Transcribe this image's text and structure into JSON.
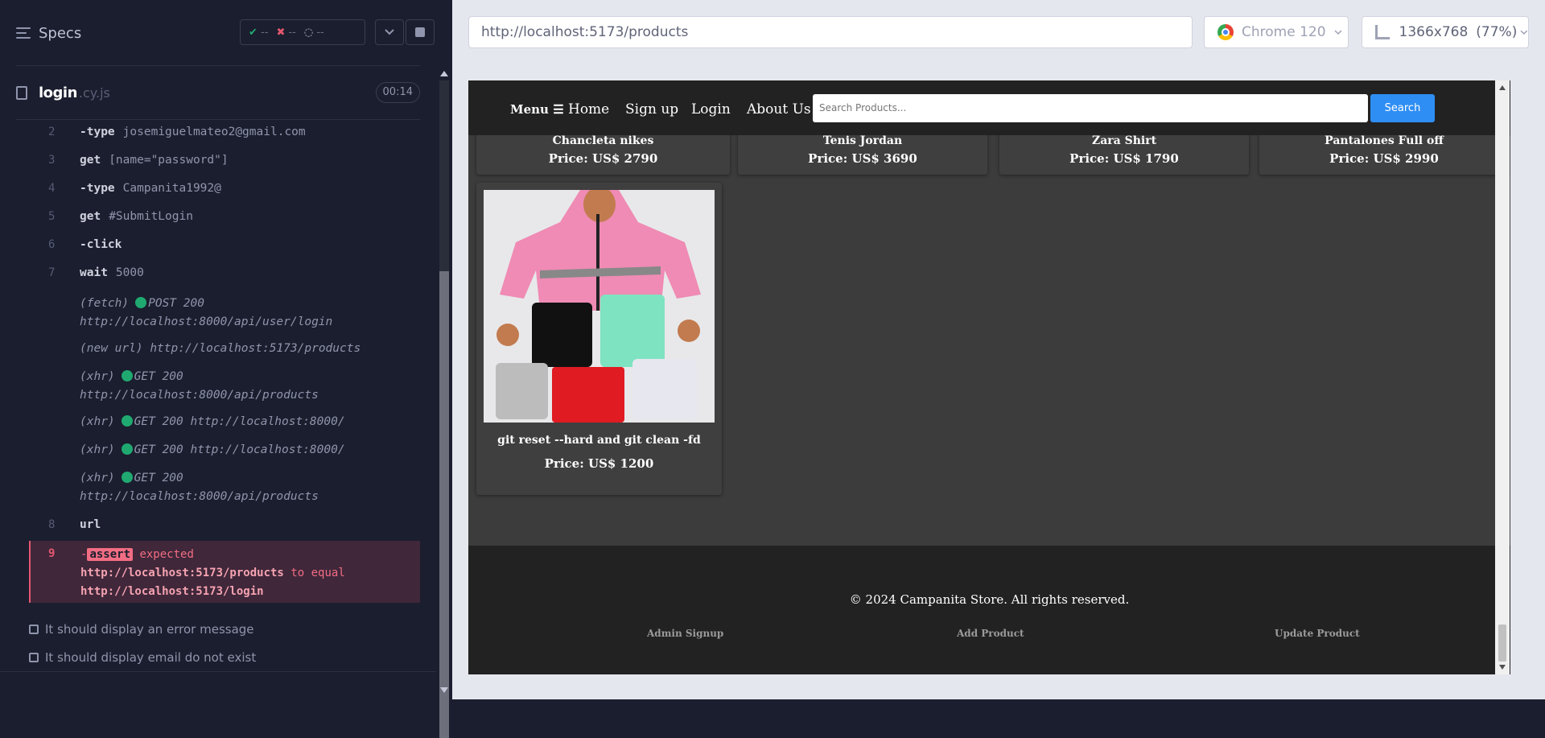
{
  "runner": {
    "title": "Specs",
    "stats": {
      "passed": "--",
      "failed": "--",
      "pending": "--"
    },
    "spec": {
      "name": "login",
      "ext": ".cy.js",
      "duration": "00:14"
    },
    "commands": [
      {
        "num": "2",
        "name": "-type",
        "arg": "josemiguelmateo2@gmail.com"
      },
      {
        "num": "3",
        "name": "get",
        "arg": "[name=\"password\"]"
      },
      {
        "num": "4",
        "name": "-type",
        "arg": "Campanita1992@"
      },
      {
        "num": "5",
        "name": "get",
        "arg": "#SubmitLogin"
      },
      {
        "num": "6",
        "name": "-click",
        "arg": ""
      },
      {
        "num": "7",
        "name": "wait",
        "arg": "5000"
      }
    ],
    "requests": [
      {
        "kind": "(fetch)",
        "line1": "POST 200",
        "line2": "http://localhost:8000/api/user/login"
      },
      {
        "kind": "(new url)",
        "line1": "http://localhost:5173/products",
        "line2": ""
      },
      {
        "kind": "(xhr)",
        "line1": "GET 200",
        "line2": "http://localhost:8000/api/products"
      },
      {
        "kind": "(xhr)",
        "line1": "GET 200 http://localhost:8000/",
        "line2": ""
      },
      {
        "kind": "(xhr)",
        "line1": "GET 200 http://localhost:8000/",
        "line2": ""
      },
      {
        "kind": "(xhr)",
        "line1": "GET 200",
        "line2": "http://localhost:8000/api/products"
      }
    ],
    "url_cmd": {
      "num": "8",
      "name": "url"
    },
    "assert": {
      "num": "9",
      "prefix": "-",
      "badge": "assert",
      "word": "expected",
      "actual": "http://localhost:5173/products",
      "to_equal": "to equal",
      "expected_url": "http://localhost:5173/login"
    },
    "pending_tests": [
      "It should display an error message",
      "It should display email do not exist"
    ]
  },
  "toolbar": {
    "url": "http://localhost:5173/products",
    "browser": "Chrome 120",
    "viewport": "1366x768",
    "zoom": "(77%)"
  },
  "app": {
    "nav": {
      "menu": "Menu",
      "home": "Home",
      "signup": "Sign up",
      "login": "Login",
      "about": "About Us"
    },
    "search": {
      "placeholder": "Search Products...",
      "button": "Search"
    },
    "products": [
      {
        "name": "Chancleta nikes",
        "price": "Price: US$ 2790"
      },
      {
        "name": "Tenis Jordan",
        "price": "Price: US$ 3690"
      },
      {
        "name": "Zara Shirt",
        "price": "Price: US$ 1790"
      },
      {
        "name": "Pantalones Full off",
        "price": "Price: US$ 2990"
      },
      {
        "name": "git reset --hard and git clean -fd",
        "price": "Price: US$ 1200"
      }
    ],
    "footer": {
      "copyright": "© 2024 Campanita Store. All rights reserved.",
      "links": [
        "Admin Signup",
        "Add Product",
        "Update Product"
      ]
    }
  },
  "colors": {
    "pass": "#1fa971",
    "fail": "#e45770",
    "accent": "#2f8ef4"
  }
}
